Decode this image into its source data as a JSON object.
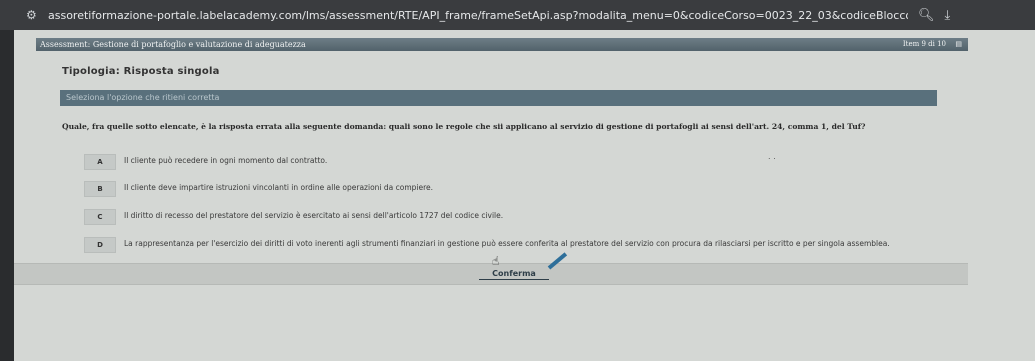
{
  "browser": {
    "url": "assoretiformazione-portale.labelacademy.com/lms/assessment/RTE/API_frame/frameSetApi.asp?modalita_menu=0&codiceCorso=0023_22_03&codiceBlocco=&session_id=392&edizion..."
  },
  "header": {
    "title": "Assessment: Gestione di portafoglio e valutazione di adeguatezza",
    "item_counter": "Item 9 di 10"
  },
  "tipologia": "Tipologia: Risposta singola",
  "instruction": "Seleziona l'opzione che ritieni corretta",
  "question": "Quale, fra quelle sotto elencate, è la risposta errata alla seguente domanda: quali sono le regole che sii applicano al servizio di gestione di portafogli ai sensi dell'art. 24, comma 1, del Tuf?",
  "answers": [
    {
      "letter": "A",
      "text": "Il cliente può recedere in ogni momento dal contratto."
    },
    {
      "letter": "B",
      "text": "Il cliente deve impartire istruzioni vincolanti in ordine alle operazioni da compiere."
    },
    {
      "letter": "C",
      "text": "Il diritto di recesso del prestatore del servizio è esercitato ai sensi dell'articolo 1727 del codice civile."
    },
    {
      "letter": "D",
      "text": "La rappresentanza per l'esercizio dei diritti di voto inerenti agli strumenti finanziari in gestione può essere conferita al prestatore del servizio con procura da rilasciarsi per iscritto e per singola assemblea."
    }
  ],
  "dots": ". .",
  "confirm_label": "Conferma"
}
